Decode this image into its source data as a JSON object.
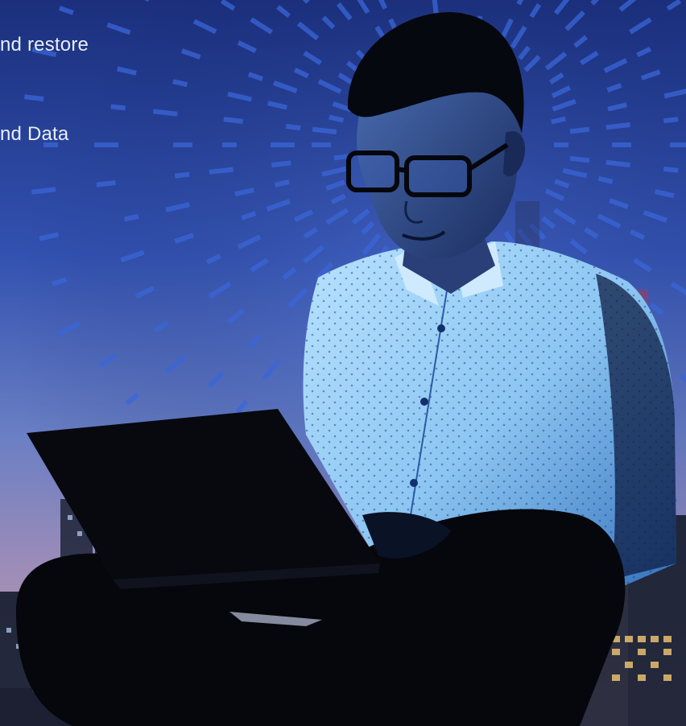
{
  "hero": {
    "text_fragments": [
      "nd restore",
      "nd Data"
    ]
  },
  "colors": {
    "sky_top": "#1c3a8e",
    "sky_mid": "#3a5ab8",
    "sky_bottom": "#8a6fa6",
    "ray_color": "#3d6ad6",
    "shirt": "#8fc7f0",
    "silhouette": "#05070d",
    "text": "#e8eef8"
  }
}
